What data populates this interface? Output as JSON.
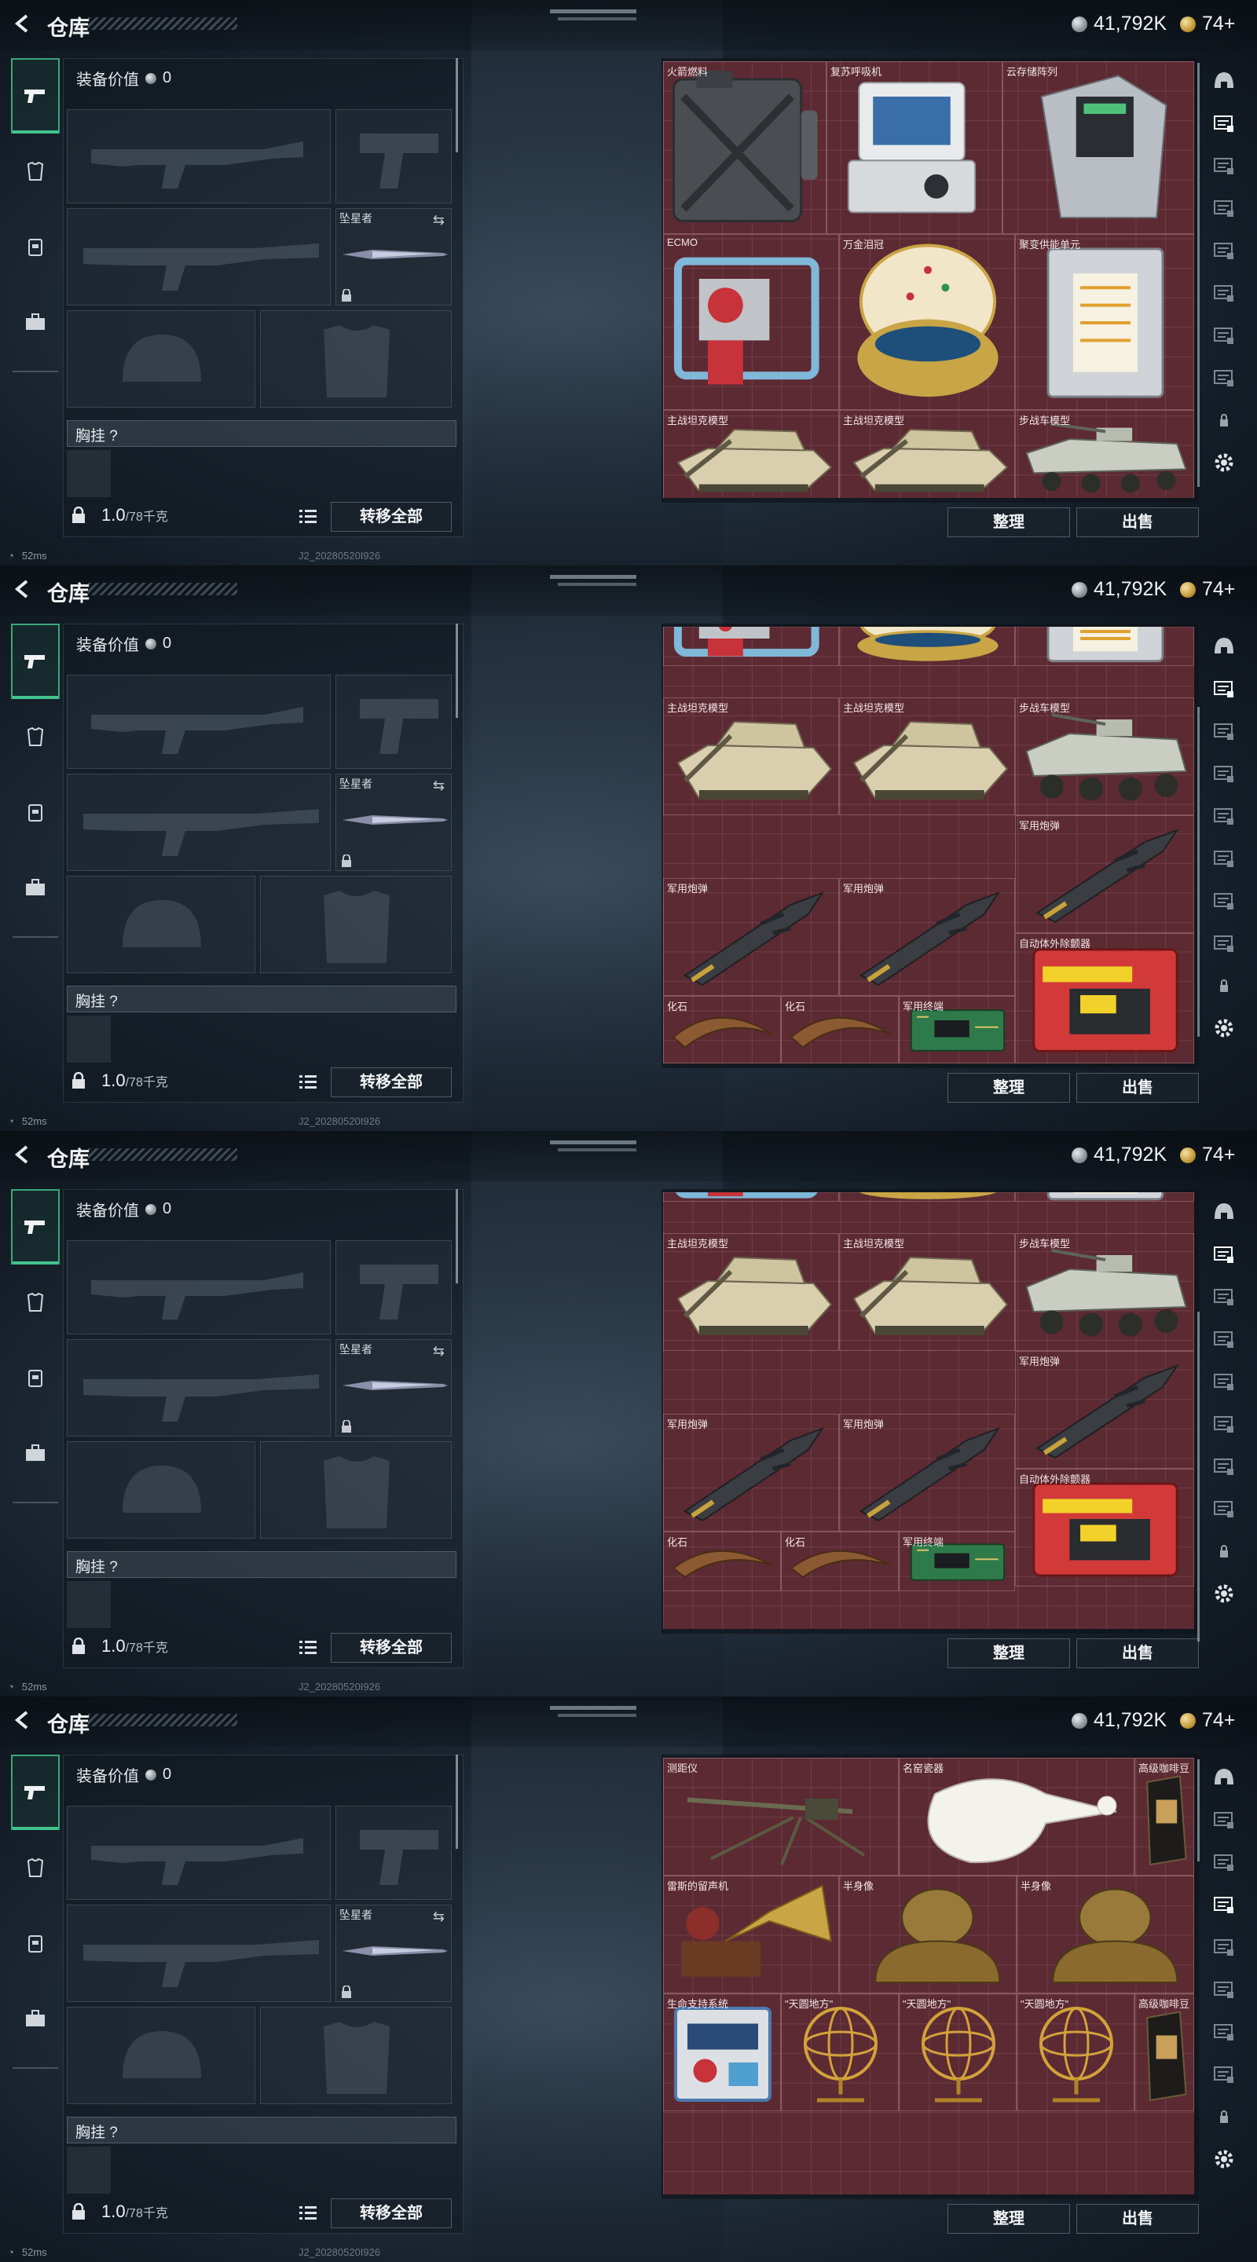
{
  "header": {
    "title": "仓库",
    "silver": "41,792K",
    "gold": "74+"
  },
  "equip": {
    "value_label": "装备价值",
    "value": "0",
    "melee_name": "坠星者",
    "vest_label": "胸挂",
    "vest_q": "?",
    "weight": "1.0",
    "weight_cap": "/78千克",
    "transfer_all": "转移全部"
  },
  "stash": {
    "sort": "整理",
    "sell": "出售"
  },
  "status": {
    "ping": "52ms",
    "build": "J2_20280520I926"
  },
  "frames": [
    {
      "items": [
        {
          "label": "火箭燃料",
          "icon": "fuel-can-icon"
        },
        {
          "label": "复苏呼吸机",
          "icon": "ventilator-icon"
        },
        {
          "label": "云存储阵列",
          "icon": "storage-array-icon"
        },
        {
          "label": "ECMO",
          "icon": "ecmo-icon"
        },
        {
          "label": "万金泪冠",
          "icon": "jeweled-egg-icon"
        },
        {
          "label": "聚变供能单元",
          "icon": "fusion-unit-icon"
        },
        {
          "label": "主战坦克模型",
          "icon": "tank-model-icon"
        },
        {
          "label": "主战坦克模型",
          "icon": "tank-model-icon"
        },
        {
          "label": "步战车模型",
          "icon": "ifv-model-icon"
        }
      ]
    },
    {
      "items": [
        {
          "label": "主战坦克模型",
          "icon": "tank-model-icon"
        },
        {
          "label": "主战坦克模型",
          "icon": "tank-model-icon"
        },
        {
          "label": "步战车模型",
          "icon": "ifv-model-icon"
        },
        {
          "label": "军用炮弹",
          "icon": "artillery-shell-icon"
        },
        {
          "label": "军用炮弹",
          "icon": "artillery-shell-icon"
        },
        {
          "label": "军用炮弹",
          "icon": "artillery-shell-icon"
        },
        {
          "label": "自动体外除颤器",
          "icon": "defibrillator-icon"
        },
        {
          "label": "化石",
          "icon": "fossil-claw-icon"
        },
        {
          "label": "化石",
          "icon": "fossil-claw-icon"
        },
        {
          "label": "军用终端",
          "icon": "circuit-board-icon"
        }
      ]
    },
    {
      "items": [
        {
          "label": "主战坦克模型",
          "icon": "tank-model-icon"
        },
        {
          "label": "主战坦克模型",
          "icon": "tank-model-icon"
        },
        {
          "label": "步战车模型",
          "icon": "ifv-model-icon"
        },
        {
          "label": "军用炮弹",
          "icon": "artillery-shell-icon"
        },
        {
          "label": "军用炮弹",
          "icon": "artillery-shell-icon"
        },
        {
          "label": "军用炮弹",
          "icon": "artillery-shell-icon"
        },
        {
          "label": "自动体外除颤器",
          "icon": "defibrillator-icon"
        },
        {
          "label": "化石",
          "icon": "fossil-claw-icon"
        },
        {
          "label": "化石",
          "icon": "fossil-claw-icon"
        },
        {
          "label": "军用终端",
          "icon": "circuit-board-icon"
        }
      ]
    },
    {
      "items": [
        {
          "label": "测距仪",
          "icon": "rangefinder-tripod-icon"
        },
        {
          "label": "名窑瓷器",
          "icon": "porcelain-vase-icon"
        },
        {
          "label": "高级咖啡豆",
          "icon": "coffee-bag-icon"
        },
        {
          "label": "雷斯的留声机",
          "icon": "gramophone-icon"
        },
        {
          "label": "半身像",
          "icon": "bronze-bust-icon"
        },
        {
          "label": "半身像",
          "icon": "bronze-bust-icon"
        },
        {
          "label": "生命支持系统",
          "icon": "life-support-icon"
        },
        {
          "label": "\"天圆地方\"",
          "icon": "armillary-sphere-icon"
        },
        {
          "label": "\"天圆地方\"",
          "icon": "armillary-sphere-icon"
        },
        {
          "label": "\"天圆地方\"",
          "icon": "armillary-sphere-icon"
        },
        {
          "label": "高级咖啡豆",
          "icon": "coffee-bag-icon"
        }
      ]
    }
  ]
}
